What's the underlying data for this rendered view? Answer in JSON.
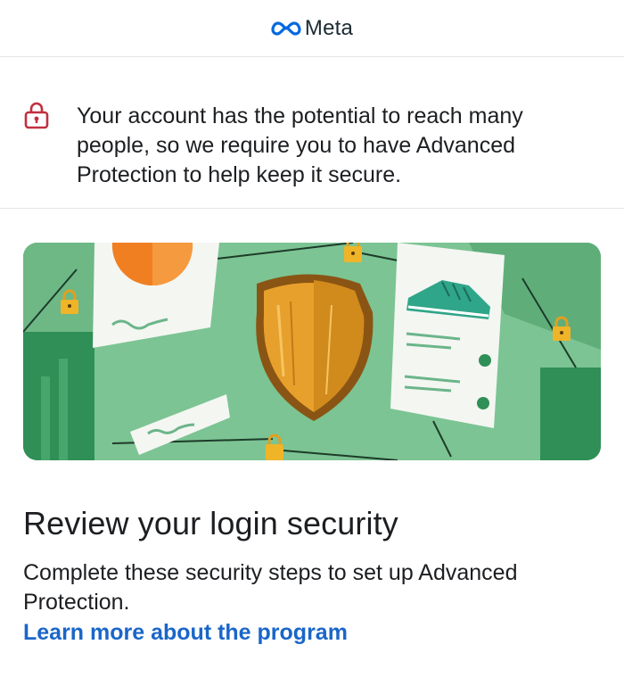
{
  "header": {
    "brand": "Meta"
  },
  "notice": {
    "icon": "lock-icon",
    "message": "Your account has the potential to reach many people, so we require you to have Advanced Protection to help keep it secure."
  },
  "illustration": {
    "icon": "shield-illustration"
  },
  "main": {
    "title": "Review your login security",
    "description": "Complete these security steps to set up Advanced Protection.",
    "learn_more": "Learn more about the program"
  },
  "colors": {
    "link": "#1a66c9",
    "lock_red": "#c0303f",
    "illustration_green": "#78c08f"
  }
}
